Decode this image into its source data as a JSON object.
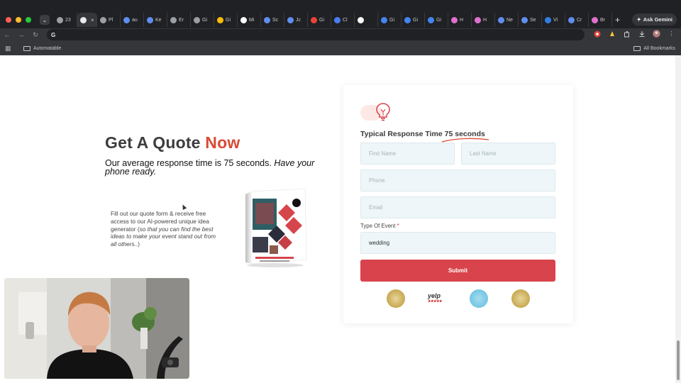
{
  "browser": {
    "tabs": [
      {
        "label": "23",
        "favicon_color": "#9aa0a6"
      },
      {
        "label": "",
        "favicon_color": "#e8eaed",
        "active": true
      },
      {
        "label": "Pl",
        "favicon_color": "#9aa0a6"
      },
      {
        "label": "au",
        "favicon_color": "#5f8ef0"
      },
      {
        "label": "Ke",
        "favicon_color": "#5f8ef0"
      },
      {
        "label": "Er",
        "favicon_color": "#9aa0a6"
      },
      {
        "label": "Gi",
        "favicon_color": "#9aa0a6"
      },
      {
        "label": "Gi",
        "favicon_color": "#fbbc04"
      },
      {
        "label": "Mi",
        "favicon_color": "#ffffff"
      },
      {
        "label": "Sc",
        "favicon_color": "#5f8ef0"
      },
      {
        "label": "Jc",
        "favicon_color": "#5f8ef0"
      },
      {
        "label": "Gi",
        "favicon_color": "#ea4335"
      },
      {
        "label": "Cl",
        "favicon_color": "#4a7ef0"
      },
      {
        "label": "",
        "favicon_color": "#ffffff"
      },
      {
        "label": "Gi",
        "favicon_color": "#4285f4"
      },
      {
        "label": "Gi",
        "favicon_color": "#4285f4"
      },
      {
        "label": "Gi",
        "favicon_color": "#4285f4"
      },
      {
        "label": "H",
        "favicon_color": "#e06fcf"
      },
      {
        "label": "H",
        "favicon_color": "#e06fcf"
      },
      {
        "label": "Ne",
        "favicon_color": "#5f8ef0"
      },
      {
        "label": "Se",
        "favicon_color": "#5f8ef0"
      },
      {
        "label": "Vi",
        "favicon_color": "#2f7fe6"
      },
      {
        "label": "Cr",
        "favicon_color": "#5f8ef0"
      },
      {
        "label": "Br",
        "favicon_color": "#e06fcf"
      }
    ],
    "new_tab": "+",
    "ask_gemini": "Ask Gemini",
    "omnibox_value": "G",
    "bookmarks": {
      "folder": "Automatable",
      "all_bookmarks": "All Bookmarks"
    }
  },
  "hero": {
    "title_main": "Get A Quote ",
    "title_accent": "Now",
    "subtitle_plain": "Our average response time is 75 seconds. ",
    "subtitle_italic": "Have your phone ready.",
    "body_plain": "Fill out our quote form & receive free access to our AI-powered unique idea generator (",
    "body_italic": "so that you can find the best ideas to make your event stand out from all others..",
    "body_end": ")"
  },
  "form": {
    "response_title_plain": "Typical Response Time ",
    "response_title_highlight": "75 seconds",
    "first_name_placeholder": "First Name",
    "last_name_placeholder": "Last Name",
    "phone_placeholder": "Phone",
    "email_placeholder": "Email",
    "event_label": "Type Of Event",
    "required_mark": "*",
    "event_value": "wedding",
    "submit_label": "Submit",
    "badges": {
      "yelp": "yelp",
      "yelp_stars": "★★★★★"
    }
  },
  "colors": {
    "accent": "#d94a36",
    "submit": "#d9434b",
    "field_bg": "#eef6f9"
  }
}
